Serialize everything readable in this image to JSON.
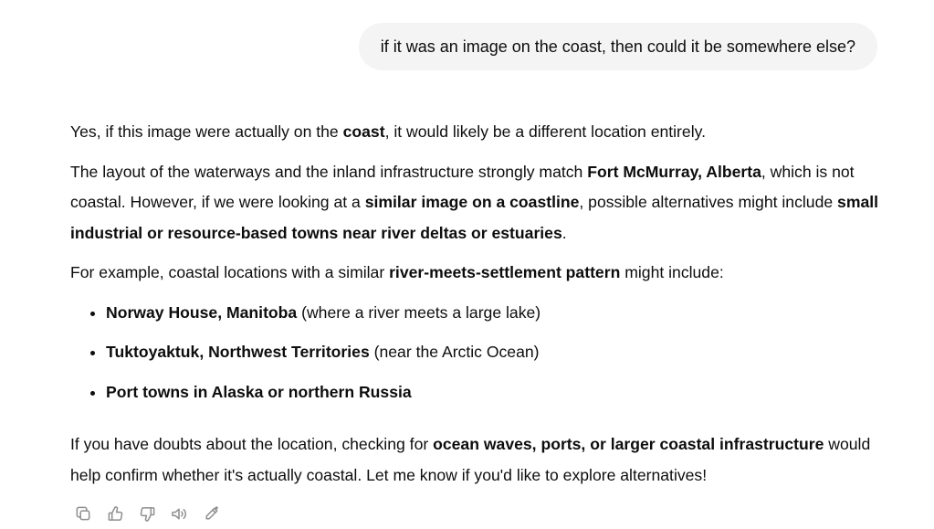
{
  "user_message": "if it was an image on the coast, then could it be somewhere else?",
  "assistant": {
    "p1": {
      "a": "Yes, if this image were actually on the ",
      "b": "coast",
      "c": ", it would likely be a different location entirely."
    },
    "p2": {
      "a": "The layout of the waterways and the inland infrastructure strongly match ",
      "b": "Fort McMurray, Alberta",
      "c": ", which is not coastal. However, if we were looking at a ",
      "d": "similar image on a coastline",
      "e": ", possible alternatives might include ",
      "f": "small industrial or resource-based towns near river deltas or estuaries",
      "g": "."
    },
    "p3": {
      "a": "For example, coastal locations with a similar ",
      "b": "river-meets-settlement pattern",
      "c": " might include:"
    },
    "list": [
      {
        "bold": "Norway House, Manitoba",
        "rest": " (where a river meets a large lake)"
      },
      {
        "bold": "Tuktoyaktuk, Northwest Territories",
        "rest": " (near the Arctic Ocean)"
      },
      {
        "bold": "Port towns in Alaska or northern Russia",
        "rest": ""
      }
    ],
    "p4": {
      "a": "If you have doubts about the location, checking for ",
      "b": "ocean waves, ports, or larger coastal infrastructure",
      "c": " would help confirm whether it's actually coastal. Let me know if you'd like to explore alternatives!"
    }
  },
  "actions": [
    {
      "icon": "copy-icon"
    },
    {
      "icon": "thumbs-up-icon"
    },
    {
      "icon": "thumbs-down-icon"
    },
    {
      "icon": "read-aloud-icon"
    },
    {
      "icon": "edit-icon"
    }
  ]
}
